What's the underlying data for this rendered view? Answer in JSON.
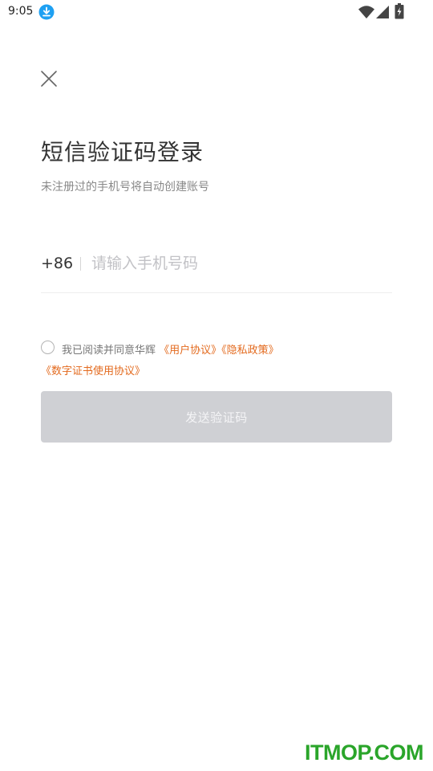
{
  "status_bar": {
    "time": "9:05",
    "icons": [
      "download-icon",
      "wifi-icon",
      "signal-icon",
      "battery-icon"
    ]
  },
  "close_icon": "close-icon",
  "title": "短信验证码登录",
  "subtitle": "未注册过的手机号将自动创建账号",
  "phone": {
    "country_code": "+86",
    "placeholder": "请输入手机号码",
    "value": ""
  },
  "agreement": {
    "checked": false,
    "text": "我已阅读并同意华辉",
    "user_agreement": "《用户协议》",
    "privacy_policy": "《隐私政策》",
    "digital_certificate_agreement": "《数字证书使用协议》"
  },
  "send_button_label": "发送验证码",
  "watermark": "ITMOP.COM",
  "colors": {
    "link": "#e36a1e",
    "button_disabled_bg": "#cfd0d4",
    "download_badge": "#1ea0f2",
    "watermark": "#2aa52a"
  }
}
